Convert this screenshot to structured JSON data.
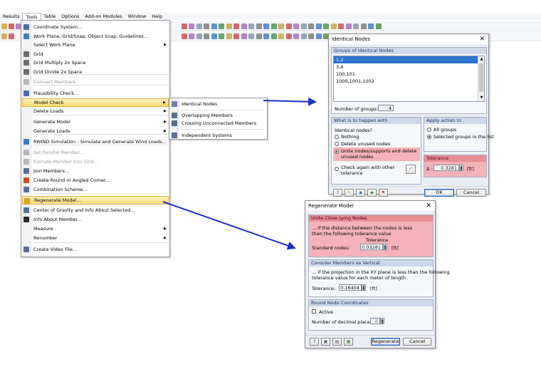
{
  "menubar": [
    "Results",
    "Tools",
    "Table",
    "Options",
    "Add-on Modules",
    "Window",
    "Help"
  ],
  "tools_menu": {
    "items": [
      {
        "label": "Coordinate System...",
        "icon": "coordinate-system-icon"
      },
      {
        "label": "Work Plane, Grid/Snap, Object Snap, Guidelines...",
        "icon": "work-plane-icon"
      },
      {
        "label": "Select Work Plane",
        "submenu": true
      },
      {
        "label": "Grid",
        "icon": "grid-icon"
      },
      {
        "label": "Grid Multiply 2x Space",
        "icon": "grid-multiply-icon"
      },
      {
        "label": "Grid Divide 2x Space",
        "icon": "grid-divide-icon"
      },
      {
        "label": "Connect Members",
        "disabled": true,
        "icon": "connect-members-icon"
      },
      {
        "label": "Plausibility Check...",
        "icon": "plausibility-icon"
      },
      {
        "label": "Model Check",
        "submenu": true,
        "highlighted": true
      },
      {
        "label": "Delete Loads",
        "submenu": true
      },
      {
        "label": "Generate Model",
        "submenu": true
      },
      {
        "label": "Generate Loads",
        "submenu": true
      },
      {
        "label": "RWIND Simulation - Simulate and Generate Wind Loads...",
        "icon": "rwind-icon"
      },
      {
        "label": "Set Parallel Member...",
        "disabled": true,
        "icon": "parallel-member-icon"
      },
      {
        "label": "Extrude Member into Grid...",
        "disabled": true,
        "icon": "extrude-icon"
      },
      {
        "label": "Join Members...",
        "icon": "join-members-icon"
      },
      {
        "label": "Create Round or Angled Corner...",
        "icon": "corner-icon"
      },
      {
        "label": "Combination Scheme...",
        "icon": "combination-scheme-icon"
      },
      {
        "label": "Regenerate Model...",
        "highlighted": true,
        "icon": "regenerate-icon"
      },
      {
        "label": "Center of Gravity and Info About Selected...",
        "icon": "center-gravity-icon"
      },
      {
        "label": "Info About Member...",
        "icon": "info-icon"
      },
      {
        "label": "Measure",
        "submenu": true
      },
      {
        "label": "Renumber",
        "submenu": true
      },
      {
        "label": "Create Video File...",
        "icon": "video-icon"
      }
    ]
  },
  "model_check_submenu": [
    "Identical Nodes",
    "Overlapping Members",
    "Crossing Unconnected Members",
    "Independent Systems"
  ],
  "identical_nodes": {
    "title": "Identical Nodes",
    "groups_header": "Groups of Identical Nodes",
    "groups": [
      "1,2",
      "3,4",
      "100,101",
      "1000,1001,1002"
    ],
    "num_groups_label": "Number of groups:",
    "num_groups": "4",
    "what_header": "What is to happen with",
    "identical_label": "Identical nodes?",
    "opt_nothing": "Nothing",
    "opt_delete": "Delete unused nodes",
    "opt_unite": "Unite nodes/supports and delete unused nodes",
    "opt_check": "Check again with other tolerance",
    "apply_header": "Apply action to",
    "opt_all_groups": "All groups",
    "opt_selected_groups": "Selected groups in the list",
    "tolerance_header": "Tolerance",
    "delta": "Δ :",
    "tolerance_value": "0.3281",
    "unit": "[ft]",
    "ok": "OK",
    "cancel": "Cancel"
  },
  "regenerate": {
    "title": "Regenerate Model",
    "unite_header": "Unite Close Lying Nodes",
    "unite_desc1": "... if the distance between the nodes is less",
    "unite_desc2": "than the following tolerance value",
    "tolerance_col": "Tolerance",
    "standard_nodes_label": "Standard nodes:",
    "standard_nodes_value": "0.03281",
    "unit": "[ft]",
    "vertical_header": "Consider Members as Vertical",
    "vertical_desc1": "... if the projection in the XY plane is less than the following",
    "vertical_desc2": "tolerance value for each meter of length",
    "tolerance_label": "Tolerance:",
    "tolerance_value": "0.16404",
    "round_header": "Round Node Coordinates",
    "active_label": "Active",
    "decimal_label": "Number of decimal places:",
    "decimal_value": "6",
    "regenerate_btn": "Regenerate",
    "cancel_btn": "Cancel"
  },
  "colors": {
    "accent_arrow": "#1f30c8",
    "highlight": "#ffd96b",
    "pink": "#f3b3b8"
  }
}
